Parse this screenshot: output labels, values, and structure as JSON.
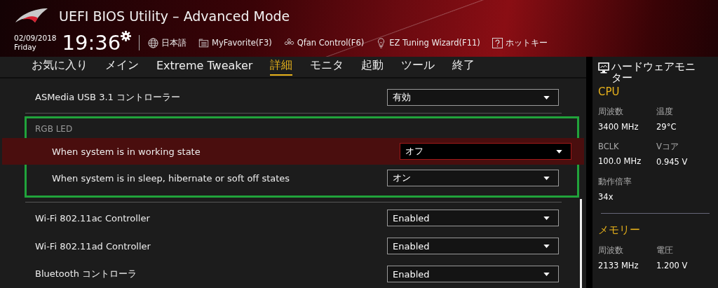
{
  "header": {
    "title": "UEFI BIOS Utility – Advanced Mode",
    "date": "02/09/2018",
    "weekday": "Friday",
    "time": "19:36",
    "tools": [
      {
        "kind": "language",
        "label": "日本語"
      },
      {
        "kind": "favorite",
        "label": "MyFavorite(F3)"
      },
      {
        "kind": "fan",
        "label": "Qfan Control(F6)"
      },
      {
        "kind": "bulb",
        "label": "EZ Tuning Wizard(F11)"
      },
      {
        "kind": "help",
        "label": "ホットキー"
      }
    ]
  },
  "tabs": [
    {
      "label": "お気に入り",
      "selected": false
    },
    {
      "label": "メイン",
      "selected": false
    },
    {
      "label": "Extreme Tweaker",
      "selected": false
    },
    {
      "label": "詳細",
      "selected": true
    },
    {
      "label": "モニタ",
      "selected": false
    },
    {
      "label": "起動",
      "selected": false
    },
    {
      "label": "ツール",
      "selected": false
    },
    {
      "label": "終了",
      "selected": false
    }
  ],
  "settings": [
    {
      "kind": "dropdown",
      "label": "ASMedia USB 3.1 コントローラー",
      "value": "有効",
      "selected": false
    },
    {
      "kind": "group",
      "label": "RGB LED",
      "outlined": true,
      "items": [
        {
          "label": "When system is in working state",
          "value": "オフ",
          "selected": true
        },
        {
          "label": "When system is in sleep, hibernate or soft off states",
          "value": "オン",
          "selected": false
        }
      ]
    },
    {
      "kind": "dropdown",
      "label": "Wi-Fi 802.11ac Controller",
      "value": "Enabled",
      "selected": false
    },
    {
      "kind": "dropdown",
      "label": "Wi-Fi 802.11ad Controller",
      "value": "Enabled",
      "selected": false
    },
    {
      "kind": "dropdown",
      "label": "Bluetooth コントローラ",
      "value": "Enabled",
      "selected": false
    }
  ],
  "monitor": {
    "title": "ハードウェアモニター",
    "sections": [
      {
        "title": "CPU",
        "fields": [
          {
            "label": "周波数",
            "value": "3400 MHz"
          },
          {
            "label": "温度",
            "value": "29°C"
          },
          {
            "label": "BCLK",
            "value": "100.0 MHz"
          },
          {
            "label": "Vコア",
            "value": "0.945 V"
          },
          {
            "label": "動作倍率",
            "value": "34x"
          }
        ]
      },
      {
        "title": "メモリー",
        "fields": [
          {
            "label": "周波数",
            "value": "2133 MHz"
          },
          {
            "label": "電圧",
            "value": "1.200 V"
          }
        ]
      }
    ]
  }
}
